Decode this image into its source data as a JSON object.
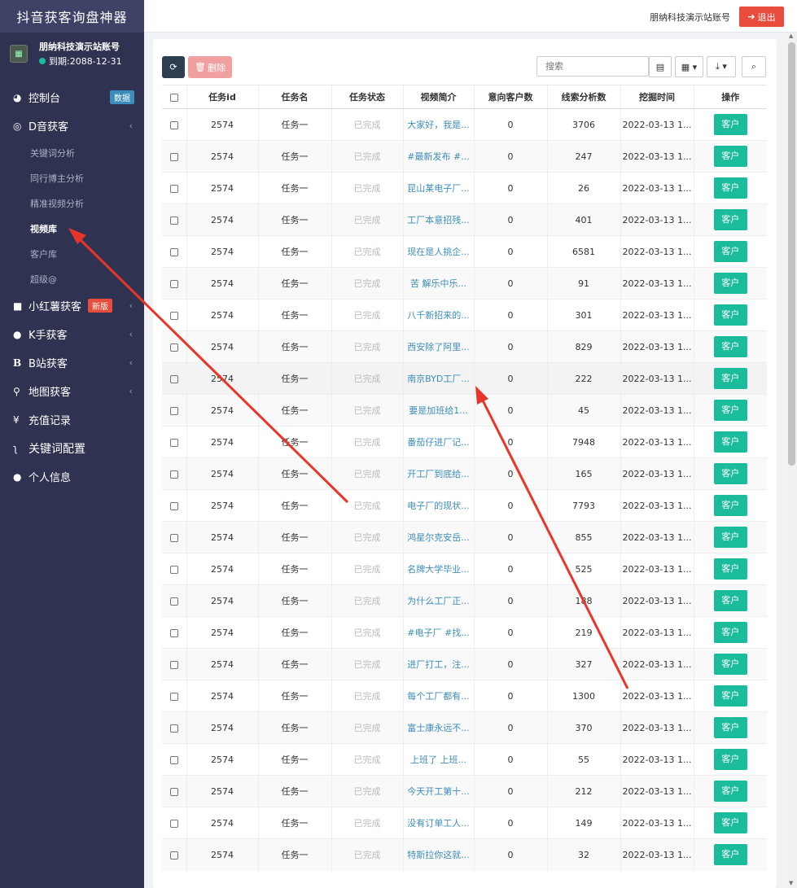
{
  "app": {
    "title": "抖音获客询盘神器"
  },
  "user": {
    "name": "朋纳科技演示站账号",
    "expire": "到期:2088-12-31"
  },
  "topbar": {
    "account": "朋纳科技演示站账号",
    "logout": "退出"
  },
  "sidebar": {
    "dashboard": {
      "label": "控制台",
      "badge": "数据"
    },
    "douyin": {
      "label": "D音获客"
    },
    "douyin_sub": [
      "关键词分析",
      "同行博主分析",
      "精准视频分析",
      "视频库",
      "客户库",
      "超级@"
    ],
    "xhs": {
      "label": "小红薯获客",
      "badge": "新版"
    },
    "kuaishou": {
      "label": "K手获客"
    },
    "bilibili": {
      "label": "B站获客"
    },
    "map": {
      "label": "地图获客"
    },
    "recharge": {
      "label": "充值记录"
    },
    "keyword_cfg": {
      "label": "关键词配置"
    },
    "profile": {
      "label": "个人信息"
    }
  },
  "toolbar": {
    "delete": "删除",
    "search_placeholder": "搜索"
  },
  "table": {
    "headers": [
      "任务id",
      "任务名",
      "任务状态",
      "视频简介",
      "意向客户数",
      "线索分析数",
      "挖掘时间",
      "操作"
    ],
    "rows": [
      {
        "id": "2574",
        "name": "任务一",
        "status": "已完成",
        "intro": "大家好，我是...",
        "intent": "0",
        "leads": "3706",
        "time": "2022-03-13 1...",
        "action": "客户"
      },
      {
        "id": "2574",
        "name": "任务一",
        "status": "已完成",
        "intro": "#最新发布 #...",
        "intent": "0",
        "leads": "247",
        "time": "2022-03-13 1...",
        "action": "客户"
      },
      {
        "id": "2574",
        "name": "任务一",
        "status": "已完成",
        "intro": "昆山某电子厂...",
        "intent": "0",
        "leads": "26",
        "time": "2022-03-13 1...",
        "action": "客户"
      },
      {
        "id": "2574",
        "name": "任务一",
        "status": "已完成",
        "intro": "工厂本意招残...",
        "intent": "0",
        "leads": "401",
        "time": "2022-03-13 1...",
        "action": "客户"
      },
      {
        "id": "2574",
        "name": "任务一",
        "status": "已完成",
        "intro": "现在是人挑企...",
        "intent": "0",
        "leads": "6581",
        "time": "2022-03-13 1...",
        "action": "客户"
      },
      {
        "id": "2574",
        "name": "任务一",
        "status": "已完成",
        "intro": "苦 解乐中乐...",
        "intent": "0",
        "leads": "91",
        "time": "2022-03-13 1...",
        "action": "客户"
      },
      {
        "id": "2574",
        "name": "任务一",
        "status": "已完成",
        "intro": "八千新招来的...",
        "intent": "0",
        "leads": "301",
        "time": "2022-03-13 1...",
        "action": "客户"
      },
      {
        "id": "2574",
        "name": "任务一",
        "status": "已完成",
        "intro": "西安除了阿里...",
        "intent": "0",
        "leads": "829",
        "time": "2022-03-13 1...",
        "action": "客户"
      },
      {
        "id": "2574",
        "name": "任务一",
        "status": "已完成",
        "intro": "南京BYD工厂...",
        "intent": "0",
        "leads": "222",
        "time": "2022-03-13 1...",
        "action": "客户"
      },
      {
        "id": "2574",
        "name": "任务一",
        "status": "已完成",
        "intro": "要是加班给1...",
        "intent": "0",
        "leads": "45",
        "time": "2022-03-13 1...",
        "action": "客户"
      },
      {
        "id": "2574",
        "name": "任务一",
        "status": "已完成",
        "intro": "番茄仔进厂记...",
        "intent": "0",
        "leads": "7948",
        "time": "2022-03-13 1...",
        "action": "客户"
      },
      {
        "id": "2574",
        "name": "任务一",
        "status": "已完成",
        "intro": "开工厂到底给...",
        "intent": "0",
        "leads": "165",
        "time": "2022-03-13 1...",
        "action": "客户"
      },
      {
        "id": "2574",
        "name": "任务一",
        "status": "已完成",
        "intro": "电子厂的现状...",
        "intent": "0",
        "leads": "7793",
        "time": "2022-03-13 1...",
        "action": "客户"
      },
      {
        "id": "2574",
        "name": "任务一",
        "status": "已完成",
        "intro": "鸿星尔克安岳...",
        "intent": "0",
        "leads": "855",
        "time": "2022-03-13 1...",
        "action": "客户"
      },
      {
        "id": "2574",
        "name": "任务一",
        "status": "已完成",
        "intro": "名牌大学毕业...",
        "intent": "0",
        "leads": "525",
        "time": "2022-03-13 1...",
        "action": "客户"
      },
      {
        "id": "2574",
        "name": "任务一",
        "status": "已完成",
        "intro": "为什么工厂正...",
        "intent": "0",
        "leads": "188",
        "time": "2022-03-13 1...",
        "action": "客户"
      },
      {
        "id": "2574",
        "name": "任务一",
        "status": "已完成",
        "intro": "#电子厂 #找...",
        "intent": "0",
        "leads": "219",
        "time": "2022-03-13 1...",
        "action": "客户"
      },
      {
        "id": "2574",
        "name": "任务一",
        "status": "已完成",
        "intro": "进厂打工，注...",
        "intent": "0",
        "leads": "327",
        "time": "2022-03-13 1...",
        "action": "客户"
      },
      {
        "id": "2574",
        "name": "任务一",
        "status": "已完成",
        "intro": "每个工厂都有...",
        "intent": "0",
        "leads": "1300",
        "time": "2022-03-13 1...",
        "action": "客户"
      },
      {
        "id": "2574",
        "name": "任务一",
        "status": "已完成",
        "intro": "富士康永远不...",
        "intent": "0",
        "leads": "370",
        "time": "2022-03-13 1...",
        "action": "客户"
      },
      {
        "id": "2574",
        "name": "任务一",
        "status": "已完成",
        "intro": "上班了 上班...",
        "intent": "0",
        "leads": "55",
        "time": "2022-03-13 1...",
        "action": "客户"
      },
      {
        "id": "2574",
        "name": "任务一",
        "status": "已完成",
        "intro": "今天开工第十...",
        "intent": "0",
        "leads": "212",
        "time": "2022-03-13 1...",
        "action": "客户"
      },
      {
        "id": "2574",
        "name": "任务一",
        "status": "已完成",
        "intro": "没有订单工人...",
        "intent": "0",
        "leads": "149",
        "time": "2022-03-13 1...",
        "action": "客户"
      },
      {
        "id": "2574",
        "name": "任务一",
        "status": "已完成",
        "intro": "特斯拉你这就...",
        "intent": "0",
        "leads": "32",
        "time": "2022-03-13 1...",
        "action": "客户"
      }
    ]
  },
  "colors": {
    "sidebar": "#2f3250",
    "accent": "#1abc9c",
    "danger": "#e74c3c",
    "link": "#3c8dbc",
    "annotation": "#e8352a"
  }
}
